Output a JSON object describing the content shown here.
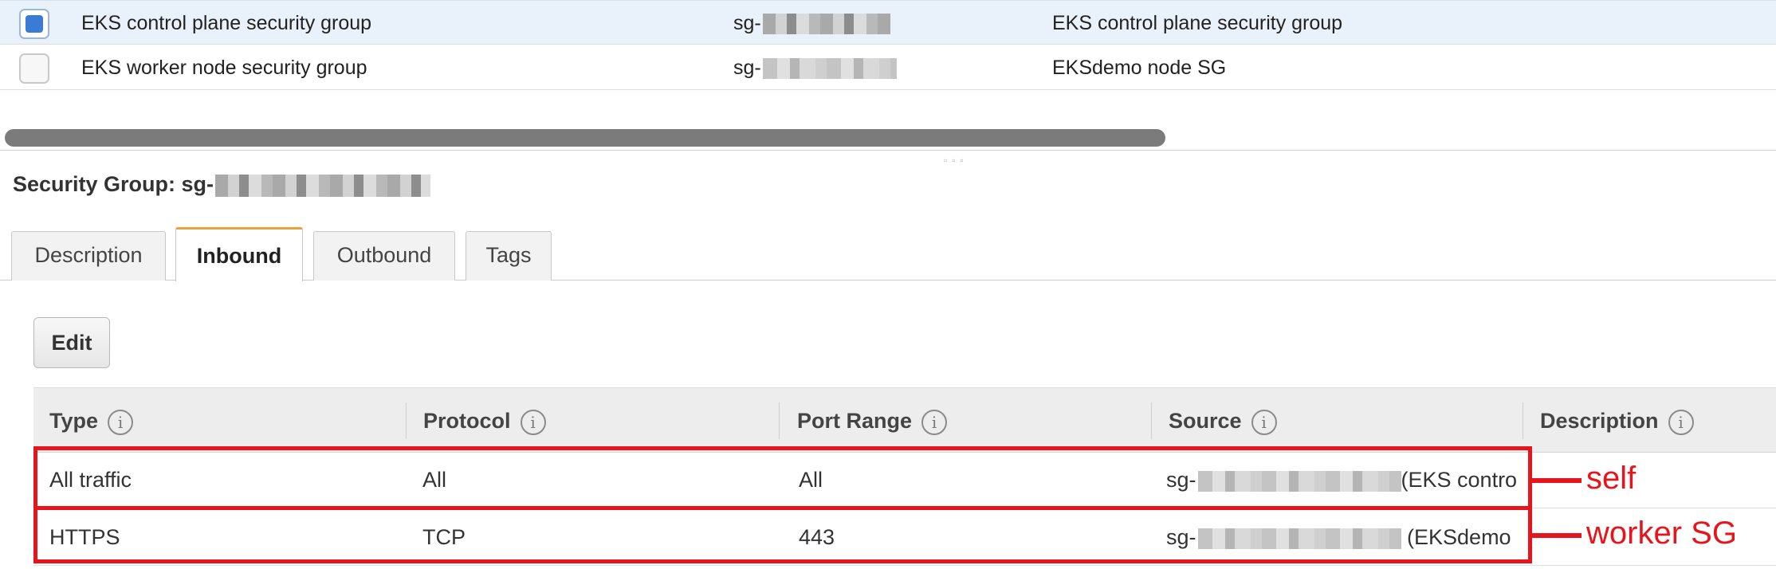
{
  "security_groups": [
    {
      "selected": true,
      "name": "EKS control plane security group",
      "id_prefix": "sg-",
      "description": "EKS control plane security group"
    },
    {
      "selected": false,
      "name": "EKS worker node security group",
      "id_prefix": "sg-",
      "description": "EKSdemo node SG"
    }
  ],
  "details": {
    "title_prefix": "Security Group: sg-"
  },
  "tabs": [
    {
      "label": "Description",
      "active": false
    },
    {
      "label": "Inbound",
      "active": true
    },
    {
      "label": "Outbound",
      "active": false
    },
    {
      "label": "Tags",
      "active": false
    }
  ],
  "edit_label": "Edit",
  "info_glyph": "i",
  "rules_table": {
    "headers": [
      "Type",
      "Protocol",
      "Port Range",
      "Source",
      "Description"
    ],
    "rows": [
      {
        "type": "All traffic",
        "protocol": "All",
        "port_range": "All",
        "source_prefix": "sg-",
        "source_suffix": "(EKS contro"
      },
      {
        "type": "HTTPS",
        "protocol": "TCP",
        "port_range": "443",
        "source_prefix": "sg-",
        "source_suffix": " (EKSdemo"
      }
    ]
  },
  "annotations": [
    "self",
    "worker SG"
  ],
  "colors": {
    "selected_row_bg": "#e9f1fb",
    "checkbox_checked": "#3a7bd5",
    "active_tab_accent": "#e8a33d",
    "annotation_red": "#e8141c"
  }
}
